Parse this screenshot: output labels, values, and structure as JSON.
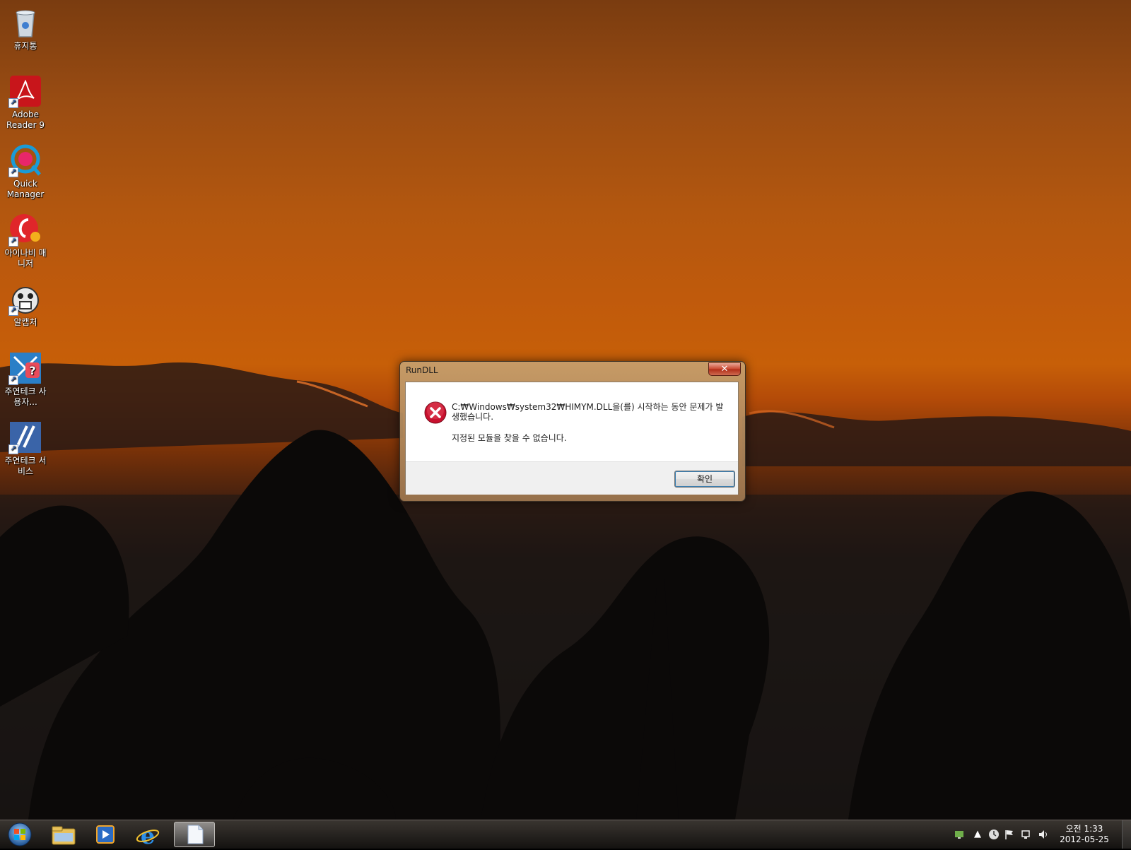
{
  "desktop": {
    "icons": [
      {
        "label": "휴지통"
      },
      {
        "label": "Adobe Reader 9"
      },
      {
        "label": "Quick Manager"
      },
      {
        "label": "아이나비 매니저"
      },
      {
        "label": "알캡처"
      },
      {
        "label": "주연테크 사용자..."
      },
      {
        "label": "주연테크 서비스"
      }
    ]
  },
  "dialog": {
    "title": "RunDLL",
    "close_label": "✕",
    "message": "C:₩Windows₩system32₩HIMYM.DLL을(를) 시작하는 동안 문제가 발생했습니다.",
    "detail": "지정된 모듈을 찾을 수 없습니다.",
    "ok_label": "확인"
  },
  "taskbar": {
    "clock_time": "오전 1:33",
    "clock_date": "2012-05-25"
  },
  "colors": {
    "sky_top": "#7a3c10",
    "sky_glow": "#c75f08",
    "ground": "#141110",
    "error_red": "#c8102e",
    "close_red": "#c9452d"
  },
  "icons": [
    "recycle-bin-icon",
    "adobe-reader-icon",
    "quick-manager-icon",
    "inavi-manager-icon",
    "alcapture-icon",
    "jooyon-user-icon",
    "jooyon-service-icon",
    "error-icon",
    "windows-start-icon",
    "explorer-icon",
    "media-player-icon",
    "internet-explorer-icon",
    "notepad-icon"
  ]
}
